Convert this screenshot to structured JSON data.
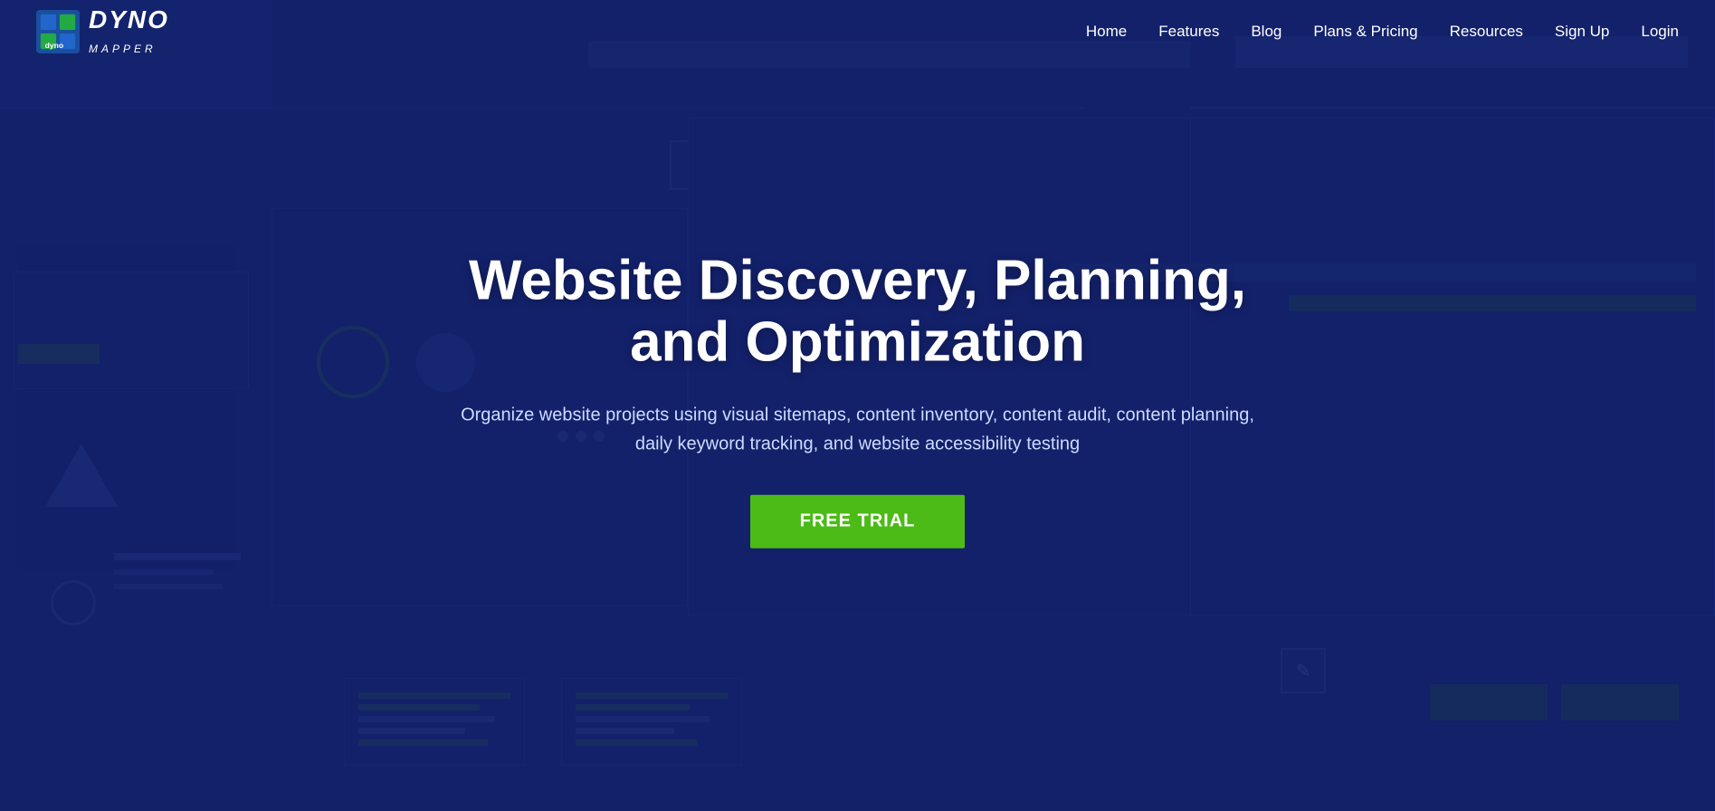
{
  "brand": {
    "name": "DYNO MAPPER",
    "logo_alt": "Dyno Mapper Logo"
  },
  "nav": {
    "links": [
      {
        "label": "Home",
        "id": "home"
      },
      {
        "label": "Features",
        "id": "features"
      },
      {
        "label": "Blog",
        "id": "blog"
      },
      {
        "label": "Plans & Pricing",
        "id": "plans-pricing"
      },
      {
        "label": "Resources",
        "id": "resources"
      },
      {
        "label": "Sign Up",
        "id": "signup"
      },
      {
        "label": "Login",
        "id": "login"
      }
    ]
  },
  "hero": {
    "title_line1": "Website Discovery, Planning,",
    "title_line2": "and Optimization",
    "subtitle": "Organize website projects using visual sitemaps, content inventory, content audit,\ncontent planning, daily keyword tracking, and website accessibility testing",
    "cta_label": "FREE TRIAL"
  },
  "colors": {
    "bg_dark_blue": "#1a2a6c",
    "accent_green": "#4cbb17",
    "nav_link": "#ffffff",
    "hero_text": "#ffffff",
    "hero_sub": "#ccdcff"
  }
}
